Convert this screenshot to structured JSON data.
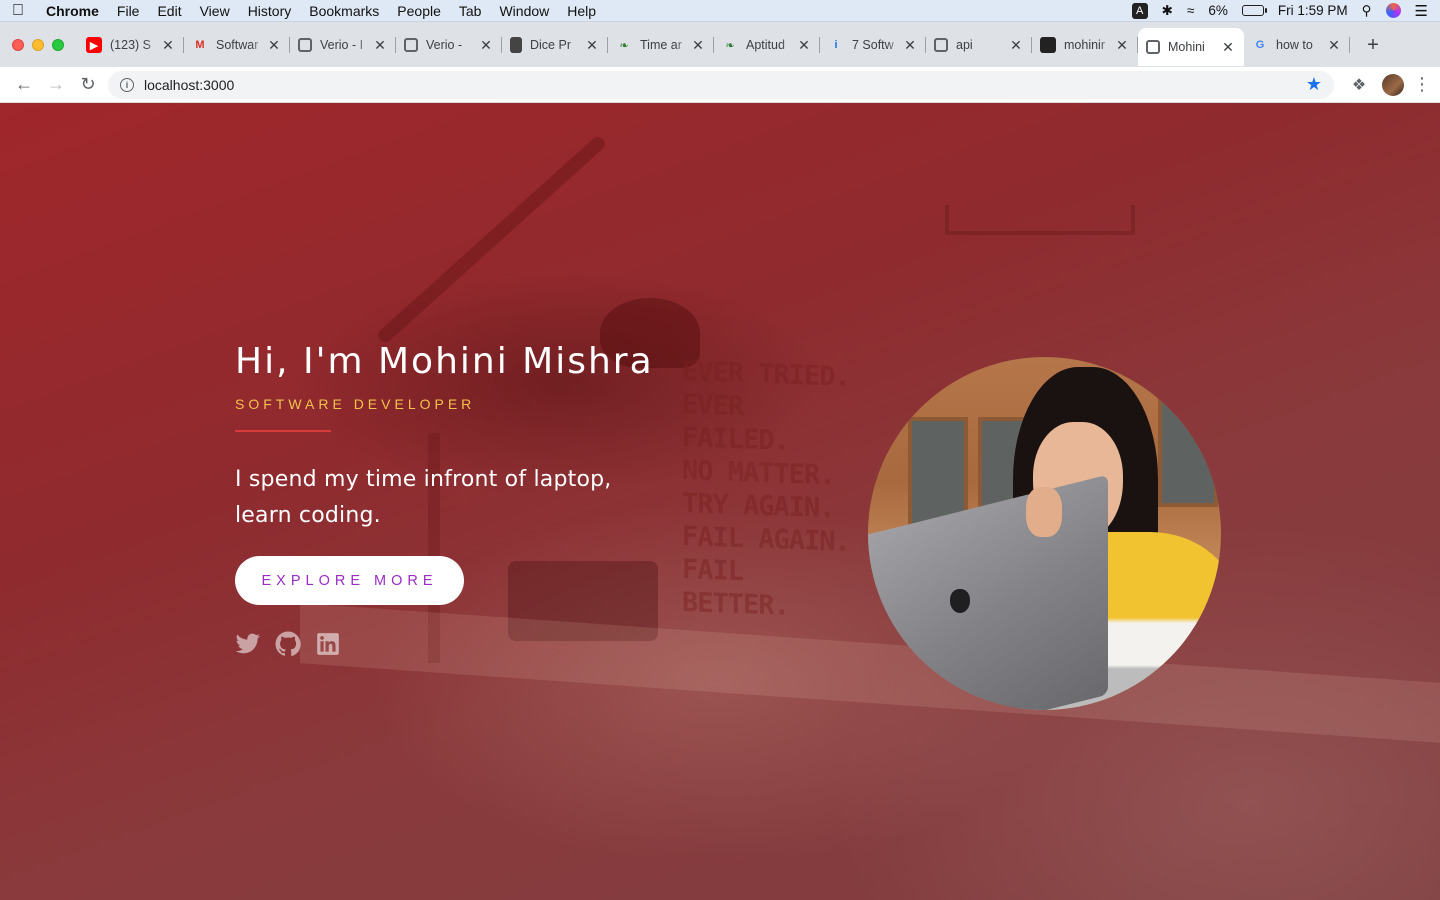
{
  "menubar": {
    "app_name": "Chrome",
    "menus": [
      "File",
      "Edit",
      "View",
      "History",
      "Bookmarks",
      "People",
      "Tab",
      "Window",
      "Help"
    ],
    "input_badge": "A",
    "battery": "6%",
    "clock": "Fri 1:59 PM"
  },
  "tabs": [
    {
      "title": "(123) S",
      "favicon": "youtube-icon"
    },
    {
      "title": "Softwar",
      "favicon": "gmail-icon"
    },
    {
      "title": "Verio - I",
      "favicon": "globe-icon"
    },
    {
      "title": "Verio -",
      "favicon": "globe-icon"
    },
    {
      "title": "Dice Pr",
      "favicon": "document-icon"
    },
    {
      "title": "Time ar",
      "favicon": "leaf-icon"
    },
    {
      "title": "Aptitud",
      "favicon": "leaf-icon"
    },
    {
      "title": "7 Softw",
      "favicon": "info-icon"
    },
    {
      "title": "api",
      "favicon": "globe-icon"
    },
    {
      "title": "mohinir",
      "favicon": "github-icon"
    },
    {
      "title": "Mohini",
      "favicon": "globe-icon",
      "active": true
    },
    {
      "title": "how to",
      "favicon": "google-icon"
    }
  ],
  "address_bar": {
    "url": "localhost:3000"
  },
  "hero": {
    "name_heading": "Hi, I'm Mohini Mishra",
    "role": "SOFTWARE DEVELOPER",
    "bio": "I spend my time infront of laptop, learn coding.",
    "cta_label": "EXPLORE MORE",
    "socials": [
      "twitter-icon",
      "github-icon",
      "linkedin-icon"
    ]
  },
  "background_poster_lines": [
    "EVER TRIED.",
    "EVER FAILED.",
    "NO MATTER.",
    "TRY AGAIN.",
    "FAIL AGAIN.",
    "FAIL BETTER."
  ],
  "colors": {
    "hero_overlay": "#a0272b",
    "role_accent": "#f3c24c",
    "divider": "#d93a3a",
    "cta_text": "#9b2cc4",
    "bookmark_star": "#1a73e8"
  }
}
